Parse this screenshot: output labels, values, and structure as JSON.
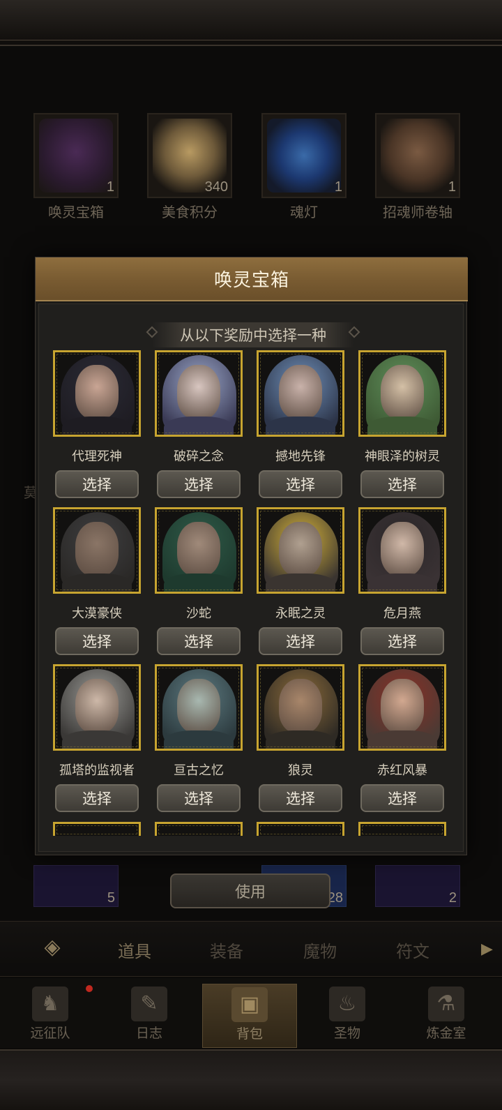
{
  "inventory_top": [
    {
      "label": "唤灵宝箱",
      "count": "1"
    },
    {
      "label": "美食积分",
      "count": "340"
    },
    {
      "label": "魂灯",
      "count": "1"
    },
    {
      "label": "招魂师卷轴",
      "count": "1"
    }
  ],
  "inventory_bottom_counts": [
    "5",
    "28",
    "2"
  ],
  "modal": {
    "title": "唤灵宝箱",
    "subtitle": "从以下奖励中选择一种",
    "select_label": "选择",
    "heroes": [
      {
        "name": "代理死神"
      },
      {
        "name": "破碎之念"
      },
      {
        "name": "撼地先锋"
      },
      {
        "name": "神眼泽的树灵"
      },
      {
        "name": "大漠豪侠"
      },
      {
        "name": "沙蛇"
      },
      {
        "name": "永眠之灵"
      },
      {
        "name": "危月燕"
      },
      {
        "name": "孤塔的监视者"
      },
      {
        "name": "亘古之忆"
      },
      {
        "name": "狼灵"
      },
      {
        "name": "赤红风暴"
      }
    ]
  },
  "use_button": "使用",
  "tabs": [
    "道具",
    "装备",
    "魔物",
    "符文"
  ],
  "nav": [
    "远征队",
    "日志",
    "背包",
    "圣物",
    "炼金室"
  ],
  "side_text": "莫"
}
